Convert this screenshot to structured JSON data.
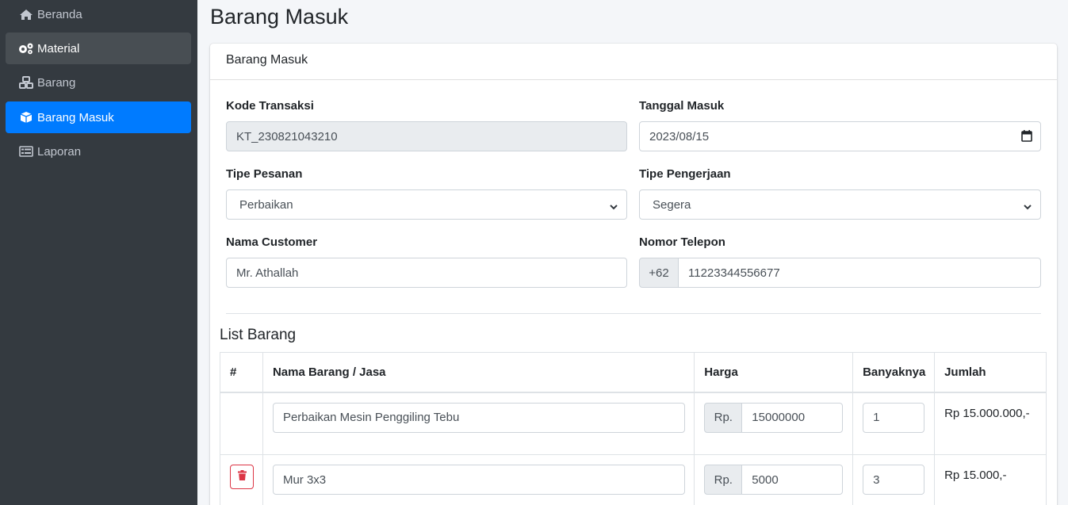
{
  "sidebar": {
    "items": [
      {
        "label": "Beranda",
        "icon": "home-icon"
      },
      {
        "label": "Material",
        "icon": "cogs-icon"
      },
      {
        "label": "Barang",
        "icon": "cubes-icon"
      },
      {
        "label": "Barang Masuk",
        "icon": "box-icon"
      },
      {
        "label": "Laporan",
        "icon": "list-icon"
      }
    ]
  },
  "page": {
    "title": "Barang Masuk"
  },
  "card": {
    "header": "Barang Masuk"
  },
  "form": {
    "kode_transaksi": {
      "label": "Kode Transaksi",
      "value": "KT_230821043210"
    },
    "tanggal_masuk": {
      "label": "Tanggal Masuk",
      "value": "2023/08/15"
    },
    "tipe_pesanan": {
      "label": "Tipe Pesanan",
      "value": "Perbaikan"
    },
    "tipe_pengerjaan": {
      "label": "Tipe Pengerjaan",
      "value": "Segera"
    },
    "nama_customer": {
      "label": "Nama Customer",
      "value": "Mr. Athallah"
    },
    "nomor_telepon": {
      "label": "Nomor Telepon",
      "prefix": "+62",
      "value": "11223344556677"
    }
  },
  "list": {
    "title": "List Barang",
    "headers": [
      "#",
      "Nama Barang / Jasa",
      "Harga",
      "Banyaknya",
      "Jumlah"
    ],
    "currency_prefix": "Rp.",
    "rows": [
      {
        "nama": "Perbaikan Mesin Penggiling Tebu",
        "harga": "15000000",
        "banyak": "1",
        "jumlah": "Rp 15.000.000,-",
        "deletable": false
      },
      {
        "nama": "Mur 3x3",
        "harga": "5000",
        "banyak": "3",
        "jumlah": "Rp 15.000,-",
        "deletable": true
      }
    ]
  },
  "colors": {
    "sidebar_bg": "#343a40",
    "active": "#007bff",
    "danger": "#dc3545"
  }
}
